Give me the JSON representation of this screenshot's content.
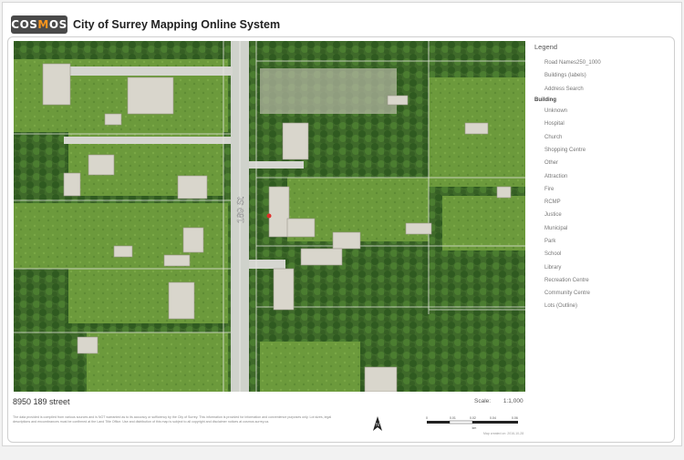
{
  "header": {
    "logo_text": "COSMOS",
    "title": "City of Surrey Mapping Online System"
  },
  "map": {
    "street_label": "189 St",
    "base_color": "#4f7a34",
    "road_color": "#cfd2cb"
  },
  "legend": {
    "title": "Legend",
    "items": [
      {
        "label": "Road Names250_1000",
        "color": "#ffffff"
      },
      {
        "label": "Buildings (labels)",
        "color": "#ffffff"
      },
      {
        "label": "Address Search",
        "color": "#ffffff"
      }
    ],
    "group_label": "Building",
    "group_items": [
      {
        "label": "Unknown",
        "color": "#ffffff"
      },
      {
        "label": "Hospital",
        "color": "#ffffff"
      },
      {
        "label": "Church",
        "color": "#ffffff"
      },
      {
        "label": "Shopping Centre",
        "color": "#ffffff"
      },
      {
        "label": "Other",
        "color": "#ffffff"
      },
      {
        "label": "Attraction",
        "color": "#ffffff"
      },
      {
        "label": "Fire",
        "color": "#ffffff"
      },
      {
        "label": "RCMP",
        "color": "#ffffff"
      },
      {
        "label": "Justice",
        "color": "#ffffff"
      },
      {
        "label": "Municipal",
        "color": "#ffffff"
      },
      {
        "label": "Park",
        "color": "#ffffff"
      },
      {
        "label": "School",
        "color": "#ffffff"
      },
      {
        "label": "Library",
        "color": "#ffffff"
      },
      {
        "label": "Recreation Centre",
        "color": "#ffffff"
      },
      {
        "label": "Community Centre",
        "color": "#ffffff"
      },
      {
        "label": "Lots (Outline)",
        "color": "#ffffff"
      }
    ]
  },
  "footer": {
    "address": "8950 189 street",
    "scale_label": "Scale:",
    "scale_value": "1:1,000",
    "disclaimer": "The data provided is compiled from various sources and is NOT warranted as to its accuracy or sufficiency by the City of Surrey. This information is provided for information and convenience purposes only. Lot sizes, legal descriptions and encumbrances must be confirmed at the Land Title Office. Use and distribution of this map is subject to all copyright and disclaimer notices at cosmos.surrey.ca.",
    "north_label": "N",
    "scalebar_ticks": [
      "0",
      "0.01",
      "0.02",
      "0.04",
      "0.06"
    ],
    "scalebar_unit": "km",
    "map_ref": "Map created on: 2016-10-28"
  }
}
